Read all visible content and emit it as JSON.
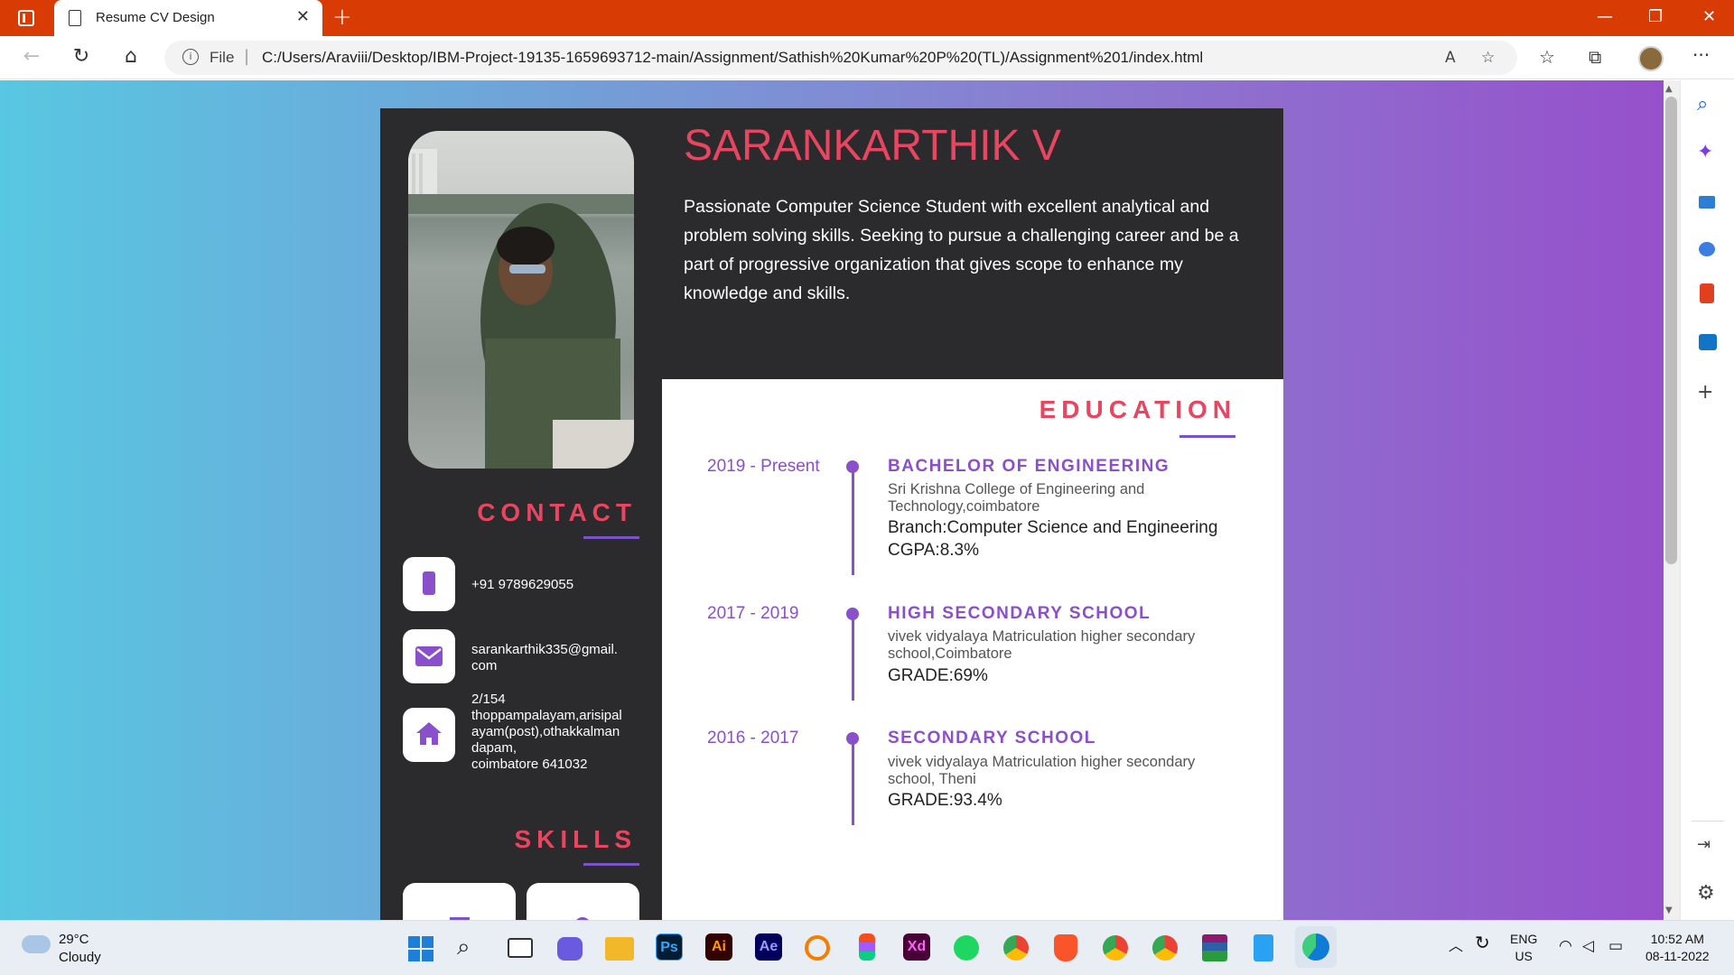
{
  "browser": {
    "tab_title": "Resume CV Design",
    "tab_close": "✕",
    "new_tab": "+",
    "window_controls": [
      "—",
      "❐",
      "✕"
    ],
    "file_label": "File",
    "url": "C:/Users/Araviii/Desktop/IBM-Project-19135-1659693712-main/Assignment/Sathish%20Kumar%20P%20(TL)/Assignment%201/index.html",
    "more_menu": "···"
  },
  "resume": {
    "name": "SARANKARTHIK V",
    "summary": "Passionate Computer Science Student with excellent analytical and problem solving skills. Seeking to pursue a challenging career and be a part of progressive organization that gives scope to enhance my knowledge and skills.",
    "contact_heading": "CONTACT",
    "contact": {
      "phone": "+91 9789629055",
      "email_line1": "sarankarthik335@gmail.",
      "email_line2": "com",
      "address_line1": "2/154",
      "address_line2": "thoppampalayam,arisipal",
      "address_line3": "ayam(post),othakkalman",
      "address_line4": "dapam,",
      "address_line5": "coimbatore 641032"
    },
    "skills_heading": "SKILLS",
    "education_heading": "EDUCATION",
    "education": [
      {
        "years": "2019 - Present",
        "degree": "BACHELOR OF ENGINEERING",
        "school": "Sri Krishna College of Engineering and Technology,coimbatore",
        "extra1": "Branch:Computer Science and Engineering",
        "extra2": "CGPA:8.3%"
      },
      {
        "years": "2017 - 2019",
        "degree": "HIGH SECONDARY SCHOOL",
        "school": "vivek vidyalaya Matriculation higher secondary school,Coimbatore",
        "extra1": "GRADE:69%"
      },
      {
        "years": "2016 - 2017",
        "degree": "SECONDARY SCHOOL",
        "school": "vivek vidyalaya Matriculation higher secondary school, Theni",
        "extra1": "GRADE:93.4%"
      }
    ]
  },
  "taskbar": {
    "weather_temp": "29°C",
    "weather_desc": "Cloudy",
    "apps": [
      "Ps",
      "Ai",
      "Ae",
      "Xd"
    ],
    "lang_line1": "ENG",
    "lang_line2": "US",
    "time": "10:52 AM",
    "date": "08-11-2022"
  },
  "colors": {
    "accent_red": "#e84660",
    "accent_purple": "#8a4fcb",
    "card_dark": "#2b2b2e",
    "titlebar": "#d93b05"
  }
}
